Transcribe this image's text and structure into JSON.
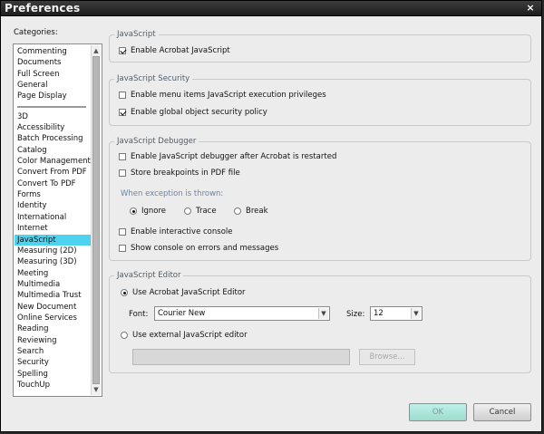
{
  "window": {
    "title": "Preferences",
    "close_glyph": "×"
  },
  "categories": {
    "label": "Categories:",
    "top_items": [
      "Commenting",
      "Documents",
      "Full Screen",
      "General",
      "Page Display"
    ],
    "bottom_items": [
      "3D",
      "Accessibility",
      "Batch Processing",
      "Catalog",
      "Color Management",
      "Convert From PDF",
      "Convert To PDF",
      "Forms",
      "Identity",
      "International",
      "Internet",
      "JavaScript",
      "Measuring (2D)",
      "Measuring (3D)",
      "Meeting",
      "Multimedia",
      "Multimedia Trust",
      "New Document",
      "Online Services",
      "Reading",
      "Reviewing",
      "Search",
      "Security",
      "Spelling",
      "TouchUp"
    ],
    "selected": "JavaScript"
  },
  "groups": {
    "javascript": {
      "title": "JavaScript",
      "enable_js": {
        "label": "Enable Acrobat JavaScript",
        "checked": true
      }
    },
    "security": {
      "title": "JavaScript Security",
      "menu_privileges": {
        "label": "Enable menu items JavaScript execution privileges",
        "checked": false
      },
      "global_policy": {
        "label": "Enable global object security policy",
        "checked": true
      }
    },
    "debugger": {
      "title": "JavaScript Debugger",
      "enable_debugger": {
        "label": "Enable JavaScript debugger after Acrobat is restarted",
        "checked": false
      },
      "store_breakpoints": {
        "label": "Store breakpoints in PDF file",
        "checked": false
      },
      "exception_label": "When exception is thrown:",
      "exception_options": [
        "Ignore",
        "Trace",
        "Break"
      ],
      "exception_selected": "Ignore",
      "interactive_console": {
        "label": "Enable interactive console",
        "checked": false
      },
      "console_errors": {
        "label": "Show console on errors and messages",
        "checked": false
      }
    },
    "editor": {
      "title": "JavaScript Editor",
      "use_acrobat": {
        "label": "Use Acrobat JavaScript Editor",
        "selected": true
      },
      "font_label": "Font:",
      "font_value": "Courier New",
      "size_label": "Size:",
      "size_value": "12",
      "use_external": {
        "label": "Use external JavaScript editor",
        "selected": false
      },
      "browse_label": "Browse..."
    }
  },
  "buttons": {
    "ok": "OK",
    "cancel": "Cancel"
  },
  "colors": {
    "selected_item": "#4dd2f0",
    "group_title": "#4e5d6b",
    "ok_button": "#9bdccf"
  }
}
